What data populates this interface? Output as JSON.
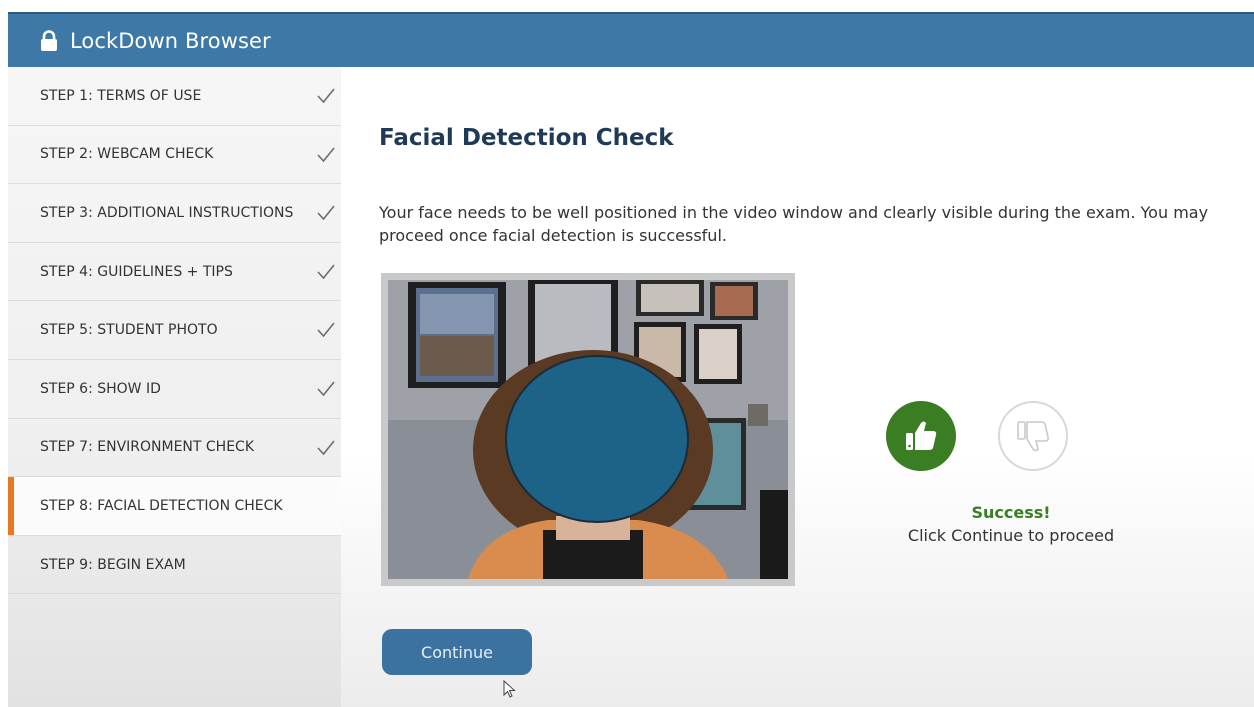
{
  "app": {
    "title": "LockDown Browser",
    "icon": "lock-icon"
  },
  "sidebar": {
    "items": [
      {
        "label": "STEP 1: TERMS OF USE",
        "done": true
      },
      {
        "label": "STEP 2: WEBCAM CHECK",
        "done": true
      },
      {
        "label": "STEP 3: ADDITIONAL INSTRUCTIONS",
        "done": true
      },
      {
        "label": "STEP 4: GUIDELINES + TIPS",
        "done": true
      },
      {
        "label": "STEP 5: STUDENT PHOTO",
        "done": true
      },
      {
        "label": "STEP 6: SHOW ID",
        "done": true
      },
      {
        "label": "STEP 7: ENVIRONMENT CHECK",
        "done": true
      },
      {
        "label": "STEP 8: FACIAL DETECTION CHECK",
        "done": false,
        "active": true
      },
      {
        "label": "STEP 9: BEGIN EXAM",
        "done": false
      }
    ],
    "active_color": "#e87722"
  },
  "main": {
    "heading": "Facial Detection Check",
    "description": "Your face needs to be well positioned in the video window and clearly visible during the exam. You may proceed once facial detection is successful.",
    "result": {
      "status": "Success!",
      "message": "Click Continue to proceed",
      "thumbs_up_icon": "thumbs-up-icon",
      "thumbs_down_icon": "thumbs-down-icon",
      "success_color": "#3a7d22"
    },
    "continue_label": "Continue"
  },
  "colors": {
    "header": "#3e78a6",
    "button": "#3c72a0",
    "face_blur": "#1d6388"
  }
}
